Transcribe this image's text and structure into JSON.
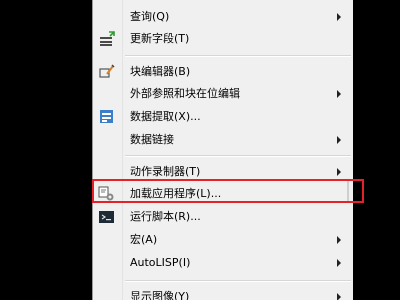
{
  "menu": {
    "items": [
      {
        "label": "查询(Q)",
        "submenu": true,
        "icon": "none"
      },
      {
        "label": "更新字段(T)",
        "submenu": false,
        "icon": "update-fields-icon"
      },
      {
        "label": "块编辑器(B)",
        "submenu": false,
        "icon": "block-editor-icon"
      },
      {
        "label": "外部参照和块在位编辑",
        "submenu": true,
        "icon": "none"
      },
      {
        "label": "数据提取(X)...",
        "submenu": false,
        "icon": "data-extraction-icon"
      },
      {
        "label": "数据链接",
        "submenu": true,
        "icon": "none"
      },
      {
        "label": "动作录制器(T)",
        "submenu": true,
        "icon": "none"
      },
      {
        "label": "加载应用程序(L)...",
        "submenu": false,
        "icon": "load-application-icon"
      },
      {
        "label": "运行脚本(R)...",
        "submenu": false,
        "icon": "run-script-icon"
      },
      {
        "label": "宏(A)",
        "submenu": true,
        "icon": "none"
      },
      {
        "label": "AutoLISP(I)",
        "submenu": true,
        "icon": "none"
      },
      {
        "label": "显示图像(Y)",
        "submenu": true,
        "icon": "none"
      }
    ]
  },
  "highlight_color": "#e8202a"
}
